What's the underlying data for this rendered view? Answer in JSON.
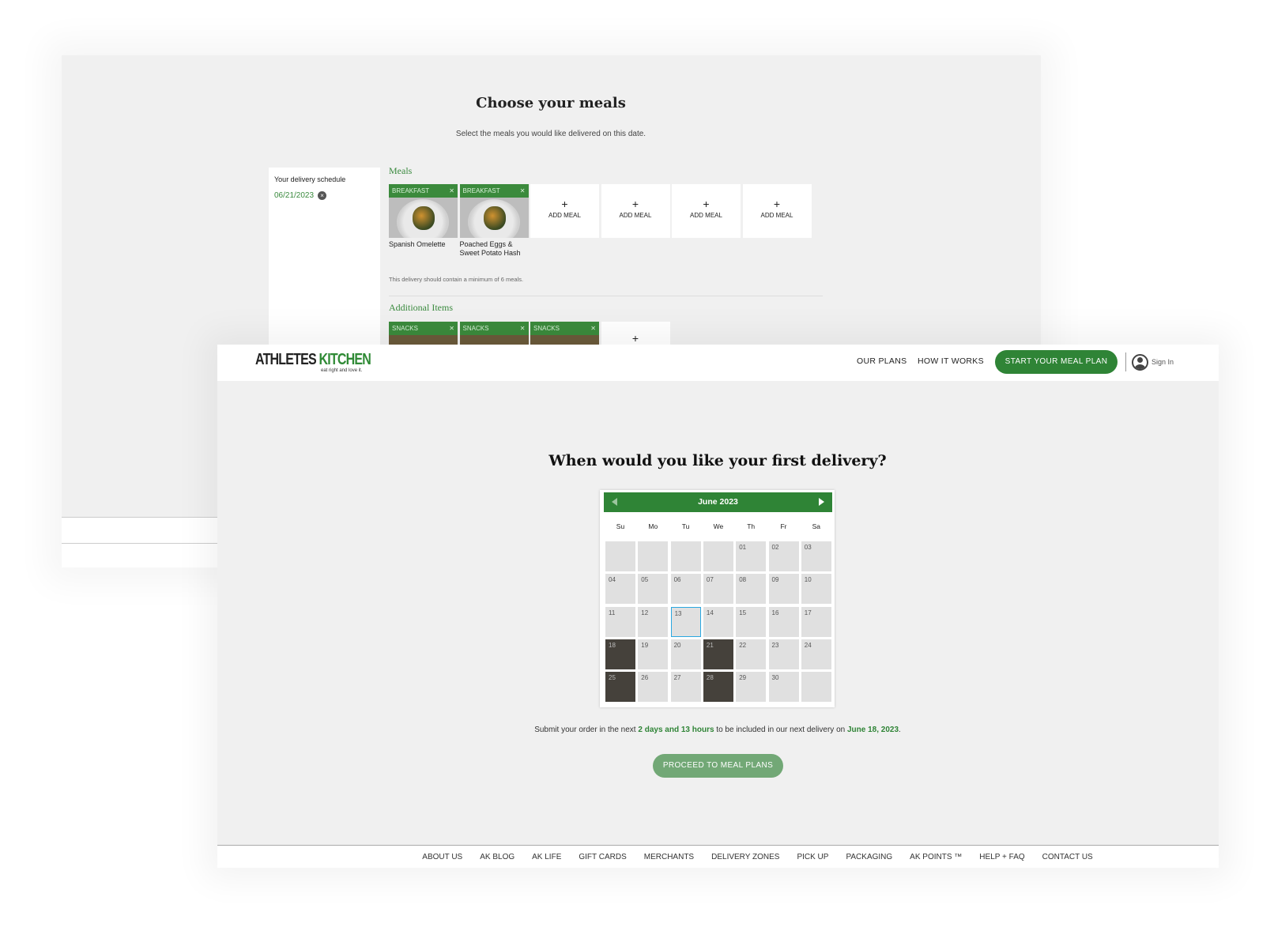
{
  "meal_page": {
    "title": "Choose your meals",
    "subtitle": "Select the meals you would like delivered on this date.",
    "schedule_label": "Your delivery schedule",
    "schedule_date": "06/21/2023",
    "meals_heading": "Meals",
    "meals": [
      {
        "tag": "BREAKFAST",
        "name": "Spanish Omelette"
      },
      {
        "tag": "BREAKFAST",
        "name": "Poached Eggs & Sweet Potato Hash"
      }
    ],
    "add_meal_label": "ADD MEAL",
    "add_meal_plus": "+",
    "remove_symbol": "✕",
    "minimum_note": "This delivery should contain a minimum of 6 meals.",
    "additional_heading": "Additional Items",
    "additional": [
      {
        "tag": "SNACKS"
      },
      {
        "tag": "SNACKS"
      },
      {
        "tag": "SNACKS"
      }
    ]
  },
  "header": {
    "logo_main": "ATHLETES ",
    "logo_accent": "KITCHEN",
    "logo_tagline": "eat right and love it.",
    "nav": [
      "OUR PLANS",
      "HOW IT WORKS"
    ],
    "cta": "START YOUR MEAL PLAN",
    "sign_in": "Sign In"
  },
  "main": {
    "heading": "When would you like your first delivery?",
    "calendar": {
      "month": "June 2023",
      "weekdays": [
        "Su",
        "Mo",
        "Tu",
        "We",
        "Th",
        "Fr",
        "Sa"
      ],
      "days": [
        "",
        "",
        "",
        "",
        "01",
        "02",
        "03",
        "04",
        "05",
        "06",
        "07",
        "08",
        "09",
        "10",
        "11",
        "12",
        "13",
        "14",
        "15",
        "16",
        "17",
        "18",
        "19",
        "20",
        "21",
        "22",
        "23",
        "24",
        "25",
        "26",
        "27",
        "28",
        "29",
        "30",
        ""
      ],
      "highlighted": [
        "18",
        "21",
        "25",
        "28"
      ],
      "today": "13"
    },
    "submit_pre": "Submit your order in the next ",
    "submit_time": "2 days and 13 hours",
    "submit_mid": " to be included in our next delivery on ",
    "submit_date": "June 18, 2023",
    "submit_end": ".",
    "proceed": "PROCEED TO MEAL PLANS"
  },
  "footer": [
    "ABOUT US",
    "AK BLOG",
    "AK LIFE",
    "GIFT CARDS",
    "MERCHANTS",
    "DELIVERY ZONES",
    "PICK UP",
    "PACKAGING",
    "AK POINTS ™",
    "HELP + FAQ",
    "CONTACT US"
  ],
  "colors": {
    "brand_green": "#2f8436",
    "muted_green": "#72a876",
    "dark_day": "#45413b",
    "today_border": "#2aa7e0"
  }
}
